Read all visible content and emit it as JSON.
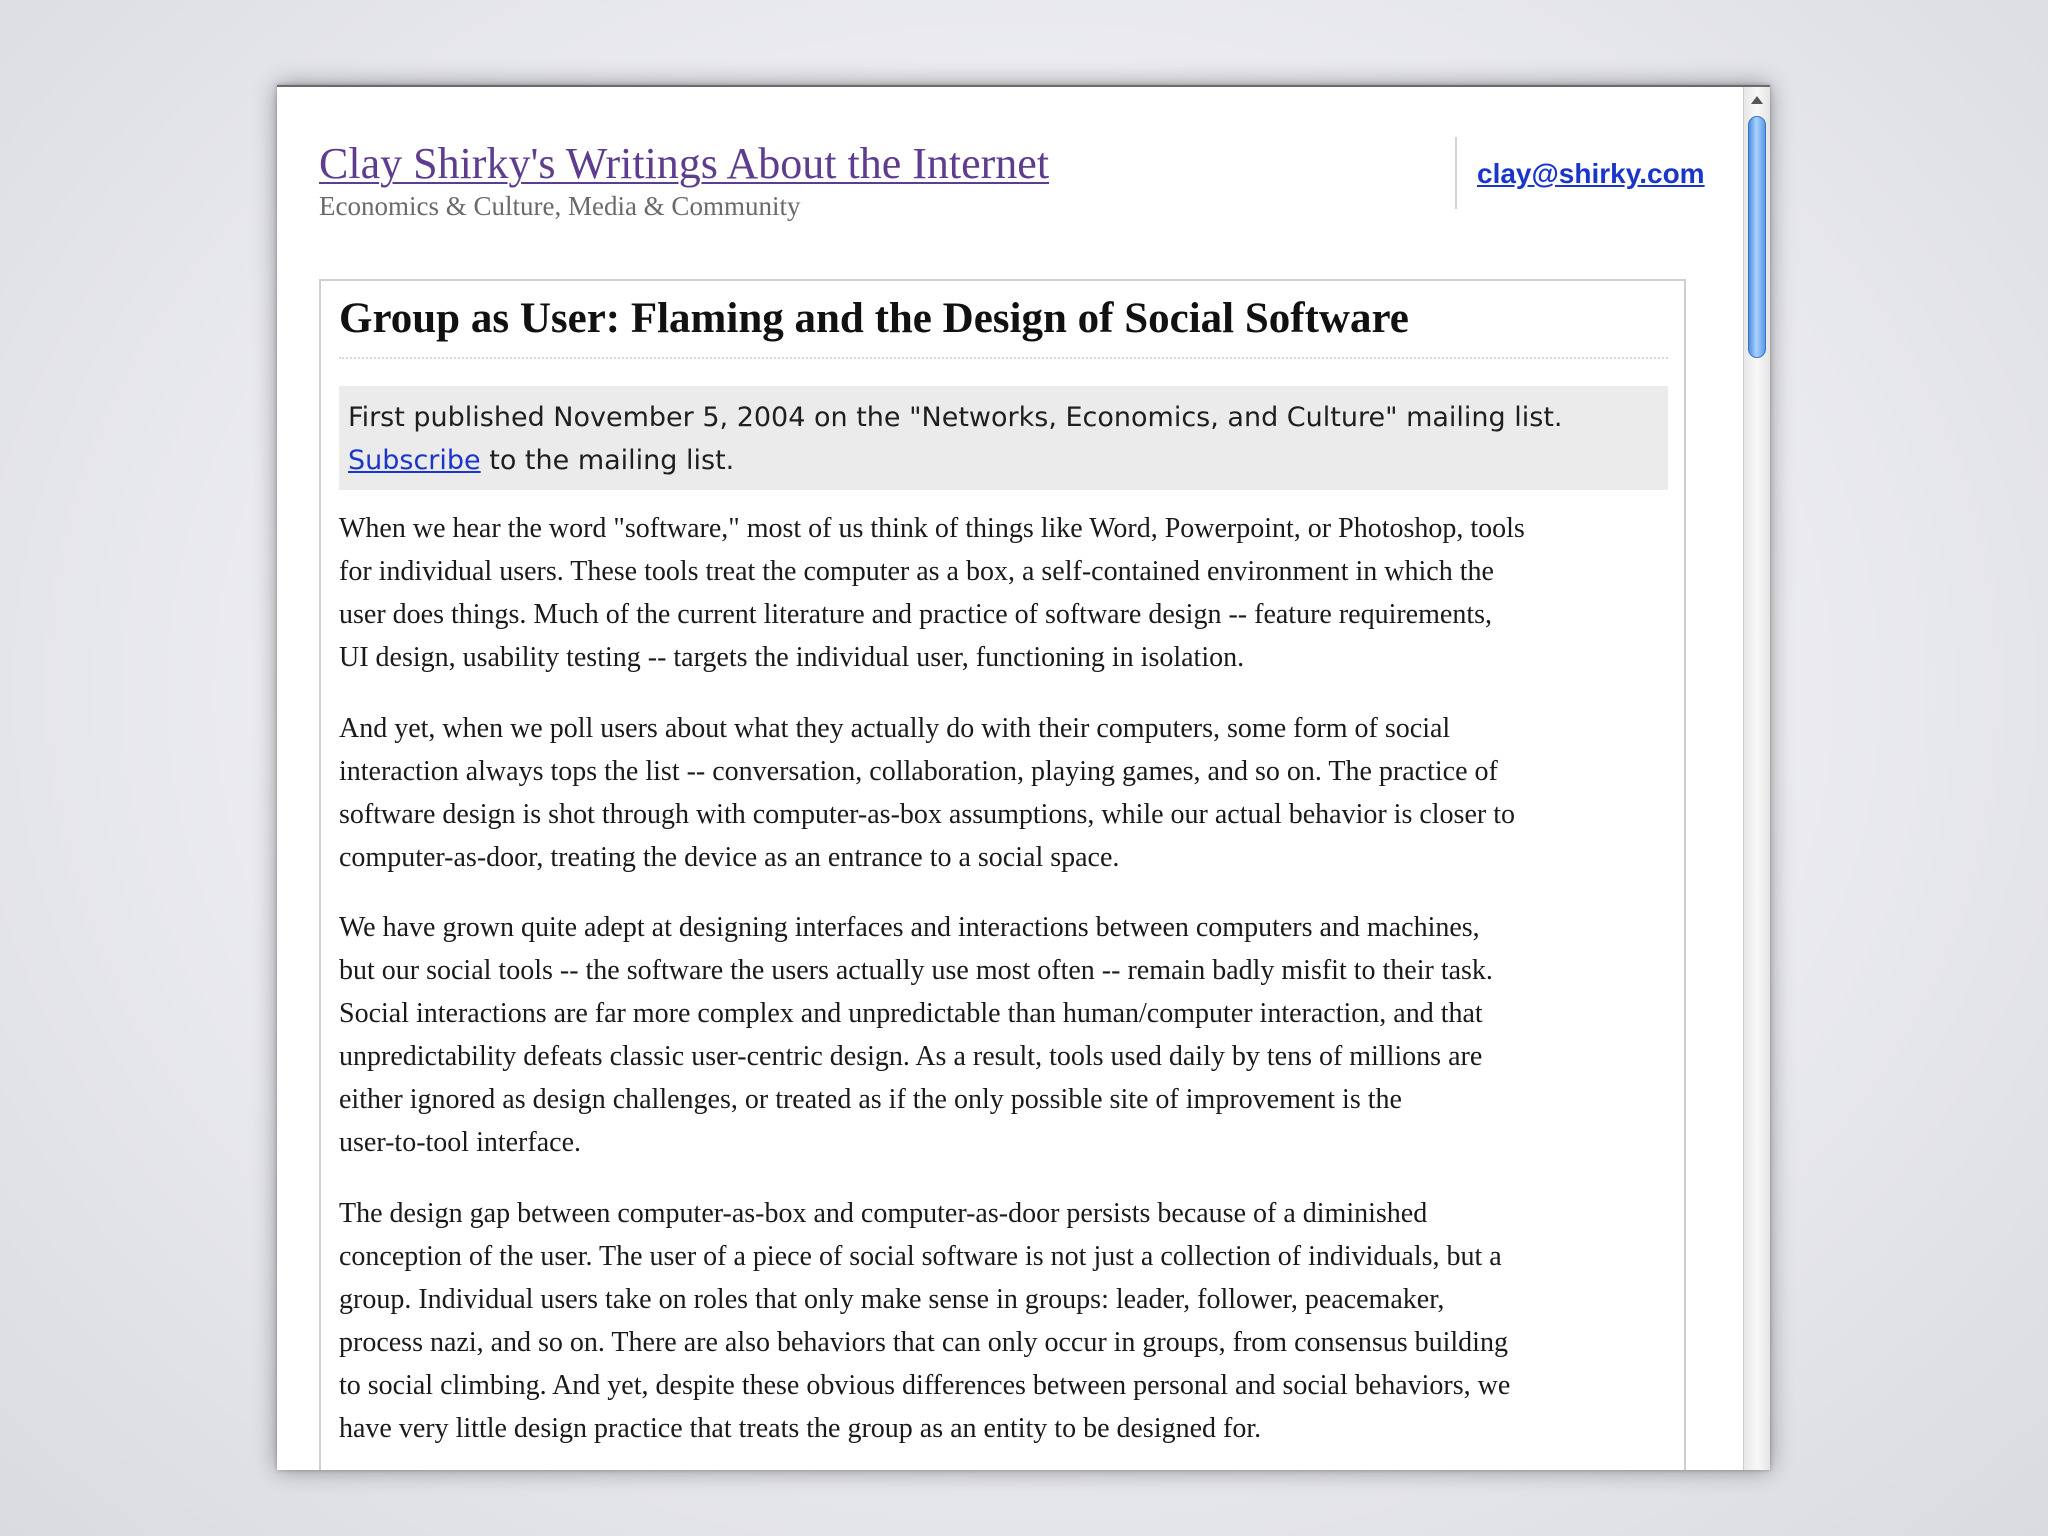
{
  "site": {
    "title": "Clay Shirky's Writings About the Internet",
    "subtitle": "Economics & Culture, Media & Community",
    "email": "clay@shirky.com"
  },
  "article": {
    "title": "Group as User: Flaming and the Design of Social Software",
    "published": "First published November 5, 2004 on the \"Networks, Economics, and Culture\" mailing list.",
    "subscribe_link": "Subscribe",
    "subscribe_rest": " to the mailing list.",
    "paragraphs": [
      [
        "When we hear the word \"software,\" most of us think of things like Word, Powerpoint, or Photoshop, tools",
        "for individual users. These tools treat the computer as a box, a self-contained environment in which the",
        "user does things. Much of the current literature and practice of software design -- feature requirements,",
        "UI design, usability testing -- targets the individual user, functioning in isolation."
      ],
      [
        "And yet, when we poll users about what they actually do with their computers, some form of social",
        "interaction always tops the list -- conversation, collaboration, playing games, and so on. The practice of",
        "software design is shot through with computer-as-box assumptions, while our actual behavior is closer to",
        "computer-as-door, treating the device as an entrance to a social space."
      ],
      [
        "We have grown quite adept at designing interfaces and interactions between computers and machines,",
        "but our social tools -- the software the users actually use most often -- remain badly misfit to their task.",
        "Social interactions are far more complex and unpredictable than human/computer interaction, and that",
        "unpredictability defeats classic user-centric design. As a result, tools used daily by tens of millions are",
        "either ignored as design challenges, or treated as if the only possible site of improvement is the",
        "user-to-tool interface."
      ],
      [
        "The design gap between computer-as-box and computer-as-door persists because of a diminished",
        "conception of the user. The user of a piece of social software is not just a collection of individuals, but a",
        "group. Individual users take on roles that only make sense in groups: leader, follower, peacemaker,",
        "process nazi, and so on. There are also behaviors that can only occur in groups, from consensus building",
        "to social climbing. And yet, despite these obvious differences between personal and social behaviors, we",
        "have very little design practice that treats the group as an entity to be designed for."
      ]
    ]
  },
  "colors": {
    "site_title": "#5e3d8f",
    "link": "#1a35cc",
    "pub_box_bg": "#ebebeb",
    "scroll_thumb": "#5d9be6"
  },
  "icons": {
    "scroll_up": "scroll-up-arrow-icon"
  }
}
